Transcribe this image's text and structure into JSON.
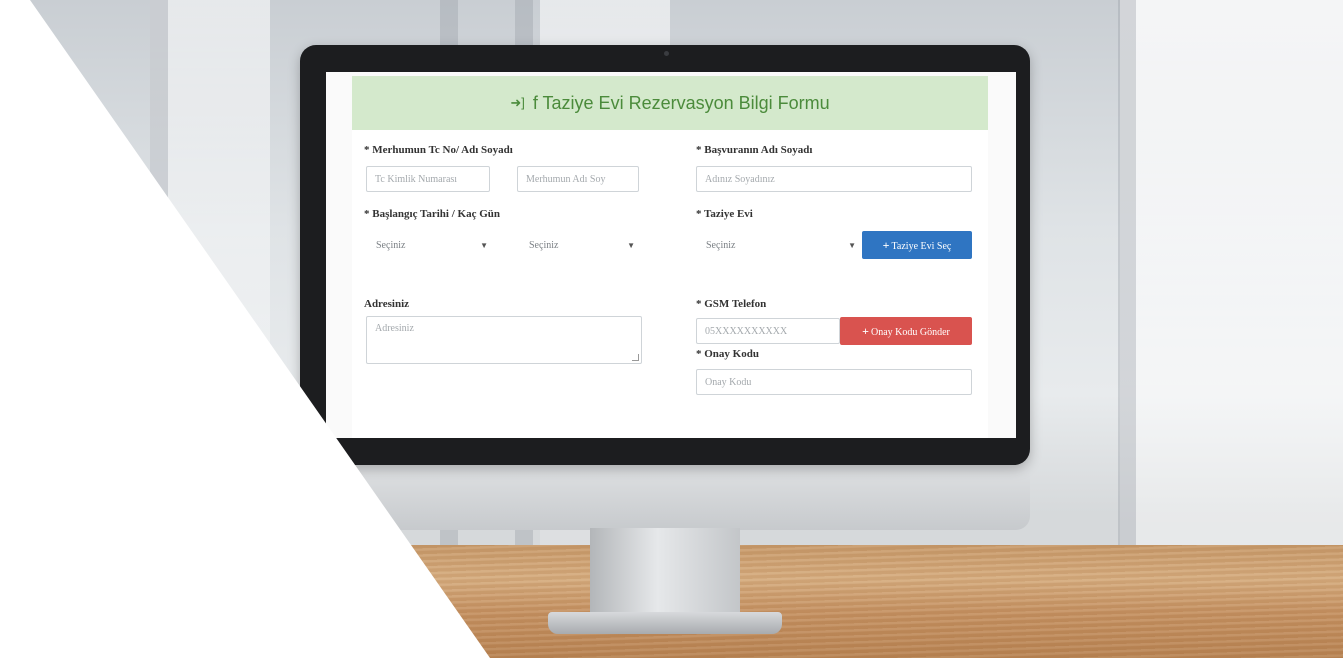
{
  "form": {
    "header_icon": "sign-in-icon",
    "title": "f Taziye Evi Rezervasyon Bilgi Formu",
    "deceased_label": "* Merhumun Tc No/ Adı Soyadı",
    "tc_placeholder": "Tc Kimlik Numarası",
    "deceased_name_placeholder": "Merhumun Adı Soy",
    "applicant_label": "* Başvuranın Adı Soyadı",
    "applicant_placeholder": "Adınız Soyadınız",
    "start_date_label": "* Başlangıç Tarihi / Kaç Gün",
    "start_select_value": "Seçiniz",
    "days_select_value": "Seçiniz",
    "house_label": "* Taziye Evi",
    "house_select_value": "Seçiniz",
    "house_button": "Taziye Evi Seç",
    "address_label": "Adresiniz",
    "address_placeholder": "Adresiniz",
    "gsm_label": "* GSM Telefon",
    "gsm_placeholder": "05XXXXXXXXXX",
    "send_code_button": "Onay Kodu Gönder",
    "code_label": "* Onay Kodu",
    "code_placeholder": "Onay Kodu"
  },
  "colors": {
    "header_bg": "#d4e9cc",
    "header_text": "#4b8b3b",
    "primary_button": "#2f75c2",
    "danger_button": "#d9534f"
  }
}
